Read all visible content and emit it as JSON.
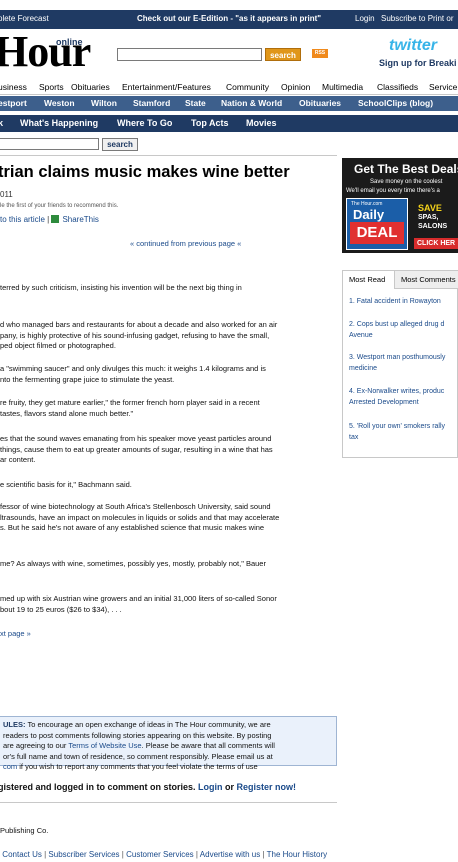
{
  "topbar": {
    "forecast": "plete Forecast",
    "edition": "Check out our E-Edition - \"as it appears in print\"",
    "login": "Login",
    "subscribe": "Subscribe to Print or"
  },
  "header": {
    "logo": "Hour",
    "logo_online": "online",
    "search_button": "search",
    "rss": "RSS",
    "twitter": "twitter",
    "twitter_signup": "Sign up for Breaki"
  },
  "nav_primary": [
    "usiness",
    "Sports",
    "Obituaries",
    "Entertainment/Features",
    "Community",
    "Opinion",
    "Multimedia",
    "Classifieds",
    "Service"
  ],
  "nav_towns": [
    "estport",
    "Weston",
    "Wilton",
    "Stamford",
    "State",
    "Nation & World",
    "Obituaries",
    "SchoolClips (blog)"
  ],
  "nav_entertainment": [
    "k",
    "What's Happening",
    "Where To Go",
    "Top Acts",
    "Movies"
  ],
  "sub_search_button": "search",
  "article": {
    "headline": "trian claims music makes wine better",
    "date": "011",
    "recommend": "le the first of your friends to recommend this.",
    "link_article": "to this article",
    "link_share": "ShareThis",
    "continued": "« continued from previous page «",
    "paragraphs": [
      "terred by such criticism, insisting his invention will be the next big thing in",
      "d who managed bars and restaurants for about a decade and also worked for an air\npany, is highly protective of his sound-infusing gadget, refusing to have the small,\nped object filmed or photographed.",
      "a \"swimming saucer\" and only divulges this much: it weighs 1.4 kilograms and is\nnto the fermenting grape juice to stimulate the yeast.",
      "re fruity, they get mature earlier,\" the former french horn player said in a recent\ntastes, flavors stand alone much better.\"",
      "es that the sound waves emanating from his speaker move yeast particles around\nthings, cause them to eat up greater amounts of sugar, resulting in a wine that has\nar content.",
      "e scientific basis for it,\" Bachmann said.",
      "fessor of wine biotechnology at South Africa's Stellenbosch University, said sound\nltrasounds, have an impact on molecules in liquids or solids and that may accelerate\ns. But he said he's not aware of any established science that music makes wine",
      "me? As always with wine, sometimes, possibly yes, mostly, probably not,\" Bauer",
      "med up with six Austrian wine growers and an initial 31,000 liters of so-called Sonor\nbout 19 to 25 euros ($26 to $34), . . ."
    ],
    "next_page": "xt page »"
  },
  "comments": {
    "rules_label": "ULES:",
    "rules_text_1": " To encourage an open exchange of ideas in The Hour community, we are",
    "rules_text_2": "readers to post comments following stories appearing on this website. By posting",
    "rules_text_3a": "are agreeing to our ",
    "rules_terms": "Terms of Website Use",
    "rules_text_3b": ". Please be aware that all comments will",
    "rules_text_4": "or's full name and town of residence, so comment responsibly. Please email us at",
    "rules_email": "com",
    "rules_text_5": " if you wish to report any comments that you feel violate the terms of use",
    "login_prefix": "gistered and logged in to comment on stories. ",
    "login_link": "Login",
    "login_or": " or ",
    "register_link": "Register now!"
  },
  "footer": {
    "copyright": "Publishing Co.",
    "links": [
      "| Contact Us",
      "Subscriber Services",
      "Customer Services",
      "Advertise with us",
      "The Hour History"
    ]
  },
  "ad": {
    "title": "Get The Best Deals",
    "sub1": "Save money on the coolest",
    "sub2": "We'll email you every time there's a",
    "daily_small": "The Hour.com",
    "daily": "Daily",
    "deal": "DEAL",
    "save1": "SAVE",
    "save2": "SPAS,",
    "save3": "SALONS",
    "click": "CLICK HER"
  },
  "most": {
    "tab_read": "Most Read",
    "tab_comments": "Most Comments",
    "items": [
      "1. Fatal accident in Rowayton",
      "2. Cops bust up alleged drug d\nAvenue",
      "3. Westport man posthumously\nmedicine",
      "4. Ex-Norwalker writes, produc\nArrested Development",
      "5. 'Roll your own' smokers rally\ntax"
    ]
  },
  "colors": {
    "navy": "#1f3a63",
    "nav_blue": "#3d5f8c",
    "link": "#1a4a8a",
    "search_orange": "#e0961a"
  }
}
